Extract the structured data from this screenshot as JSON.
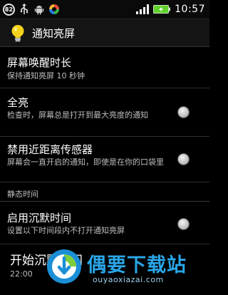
{
  "status_bar": {
    "notification_count": "82",
    "icons": [
      "usb-icon",
      "android-icon",
      "sync-icon",
      "signal-icon",
      "battery-icon"
    ],
    "time": "10:57"
  },
  "action_bar": {
    "icon": "lightbulb-icon",
    "title": "通知亮屏"
  },
  "settings": {
    "wake_duration": {
      "title": "屏幕唤醒时长",
      "summary": "保持通知亮屏 10 秒钟"
    },
    "full_brightness": {
      "title": "全亮",
      "summary": "检查时，屏幕总是打开到最大亮度的通知",
      "checked": false
    },
    "disable_proximity": {
      "title": "禁用近距离传感器",
      "summary": "屏幕会一直开启的通知，即使是在你的口袋里",
      "checked": false
    },
    "quiet_section": {
      "header": "静态时间"
    },
    "enable_quiet": {
      "title": "启用沉默时间",
      "summary": "设置以下时间段内不打开通知亮屏",
      "checked": false
    },
    "quiet_start": {
      "title": "开始沉默时间",
      "summary": "22:00"
    }
  },
  "watermark": {
    "logo_icon": "ouyaoxiazai-logo-icon",
    "text": "偶要下载站",
    "url": "ouyaoxiazai.com"
  },
  "colors": {
    "background": "#000000",
    "accent": "#2aa6e8",
    "bulb": "#f7d21b",
    "battery": "#5fd12a"
  }
}
